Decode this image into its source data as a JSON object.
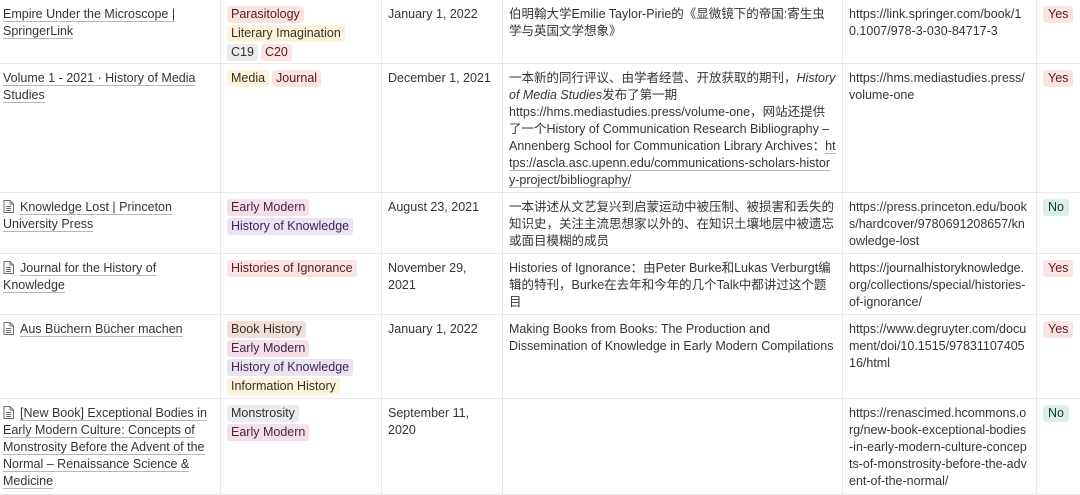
{
  "colors": {
    "tag_red": "#fbe4e4",
    "tag_orange": "#fbecdd",
    "tag_yellow": "#fbf3db",
    "tag_purple": "#eae4f2",
    "tag_gray": "#ebeced",
    "tag_brown": "#eee0da",
    "tag_pink": "#f4dfeb",
    "yes": "#fbe4e4",
    "no": "#ddedea"
  },
  "rows": [
    {
      "title": "Empire Under the Microscope | SpringerLink",
      "icon": false,
      "tags": [
        "Parasitology",
        "Literary Imagination",
        "C19",
        "C20"
      ],
      "date": "January 1, 2022",
      "notes": "伯明翰大学Emilie Taylor-Pirie的《显微镜下的帝国:寄生虫学与英国文学想象》",
      "notes_italic": "",
      "notes_rest": "",
      "notes_link": "",
      "url": "https://link.springer.com/book/10.1007/978-3-030-84717-3",
      "yn": "Yes"
    },
    {
      "title": "Volume 1 - 2021 · History of Media Studies",
      "icon": false,
      "tags": [
        "Media",
        "Journal"
      ],
      "date": "December 1, 2021",
      "notes": "一本新的同行评议、由学者经营、开放获取的期刊，",
      "notes_italic": "History of Media Studies",
      "notes_rest": "发布了第一期https://hms.mediastudies.press/volume-one，网站还提供了一个History of Communication Research Bibliography – Annenberg School for Communication Library Archives：",
      "notes_link": "https://ascla.asc.upenn.edu/communications-scholars-history-project/bibliography/",
      "url": "https://hms.mediastudies.press/volume-one",
      "yn": "Yes"
    },
    {
      "title": "Knowledge Lost | Princeton University Press",
      "icon": true,
      "tags": [
        "Early Modern",
        "History of Knowledge"
      ],
      "date": "August 23, 2021",
      "notes": "一本讲述从文艺复兴到启蒙运动中被压制、被损害和丢失的知识史，关注主流思想家以外的、在知识土壤地层中被遗忘或面目模糊的成员",
      "notes_italic": "",
      "notes_rest": "",
      "notes_link": "",
      "url": "https://press.princeton.edu/books/hardcover/9780691208657/knowledge-lost",
      "yn": "No"
    },
    {
      "title": "Journal for the History of Knowledge",
      "icon": true,
      "tags": [
        "Histories of Ignorance"
      ],
      "date": "November 29, 2021",
      "notes": "Histories of Ignorance：由Peter Burke和Lukas Verburgt编辑的特刊，Burke在去年和今年的几个Talk中都讲过这个题目",
      "notes_italic": "",
      "notes_rest": "",
      "notes_link": "",
      "url": "https://journalhistoryknowledge.org/collections/special/histories-of-ignorance/",
      "yn": "Yes"
    },
    {
      "title": "Aus Büchern Bücher machen",
      "icon": true,
      "tags": [
        "Book History",
        "Early Modern",
        "History of Knowledge",
        "Information History"
      ],
      "date": "January 1, 2022",
      "notes": "Making Books from Books: The Production and Dissemination of Knowledge in Early Modern Compilations",
      "notes_italic": "",
      "notes_rest": "",
      "notes_link": "",
      "url": "https://www.degruyter.com/document/doi/10.1515/9783110740516/html",
      "yn": "Yes"
    },
    {
      "title": "[New Book] Exceptional Bodies in Early Modern Culture: Concepts of Monstrosity Before the Advent of the Normal – Renaissance Science & Medicine",
      "icon": true,
      "tags": [
        "Monstrosity",
        "Early Modern"
      ],
      "date": "September 11, 2020",
      "notes": "",
      "notes_italic": "",
      "notes_rest": "",
      "notes_link": "",
      "url": "https://renascimed.hcommons.org/new-book-exceptional-bodies-in-early-modern-culture-concepts-of-monstrosity-before-the-advent-of-the-normal/",
      "yn": "No"
    }
  ]
}
